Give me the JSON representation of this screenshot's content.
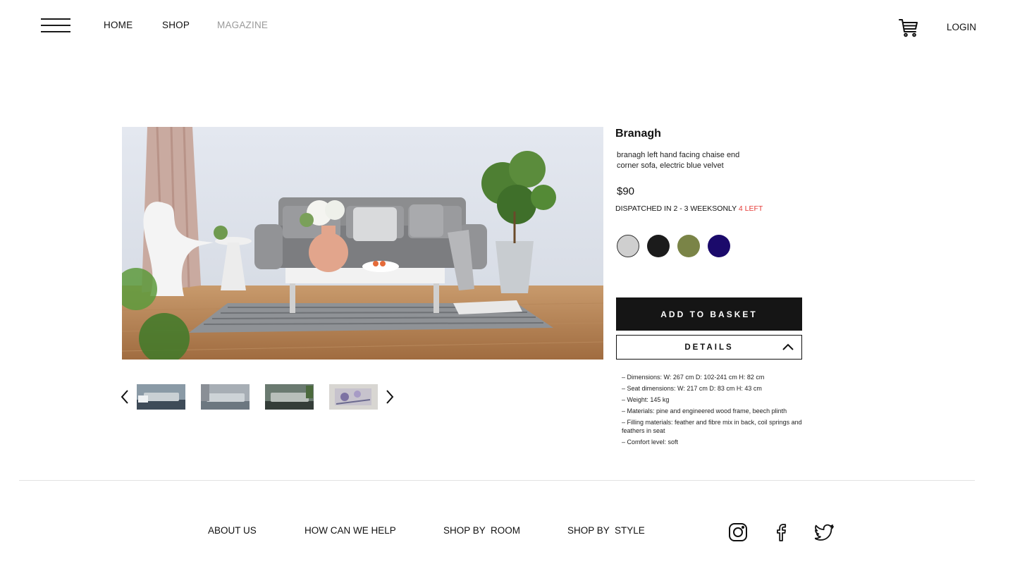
{
  "header": {
    "menu_icon": "hamburger-menu-icon",
    "nav": {
      "home": "HOME",
      "shop": "SHOP",
      "magazine": "MAGAZINE"
    },
    "cart_icon": "cart-icon",
    "login": "LOGIN"
  },
  "gallery": {
    "main_image": "living-room-grey-sofa-photo",
    "prev_icon": "chevron-left-icon",
    "next_icon": "chevron-right-icon",
    "thumbnails": [
      "sofa-thumbnail",
      "sofa-thumbnail",
      "sofa-thumbnail",
      "artwork-thumbnail"
    ]
  },
  "product": {
    "name": "Branagh",
    "description": "branagh left hand facing chaise end corner sofa, electric blue velvet",
    "price": "$90",
    "dispatch": "DISPATCHED IN 2 - 3 WEEKSONLY",
    "stock_left": "4 LEFT",
    "swatches": [
      {
        "color": "#cfcfcf",
        "selected": true
      },
      {
        "color": "#1b1b1b",
        "selected": false
      },
      {
        "color": "#7a8447",
        "selected": false
      },
      {
        "color": "#1b0a6b",
        "selected": false
      }
    ],
    "add_to_basket": "ADD TO BASKET",
    "details_label": "DETAILS",
    "details_icon": "chevron-up-icon",
    "specs": [
      "– Dimensions: W: 267 cm D: 102-241 cm H: 82 cm",
      "– Seat dimensions: W: 217 cm D: 83 cm H: 43 cm",
      "– Weight: 145 kg",
      "– Materials: pine and engineered wood frame, beech plinth",
      "– Filling materials: feather and fibre mix in back, coil springs and feathers in seat",
      "– Comfort level: soft"
    ]
  },
  "footer": {
    "links": {
      "about": "ABOUT US",
      "help": "HOW CAN WE HELP",
      "room": "SHOP BY  ROOM",
      "style": "SHOP BY  STYLE"
    },
    "social": [
      "instagram-icon",
      "facebook-icon",
      "twitter-icon"
    ]
  },
  "colors": {
    "accent_black": "#151515",
    "stock_red": "#e53935",
    "nav_muted": "#9a9a9a"
  }
}
